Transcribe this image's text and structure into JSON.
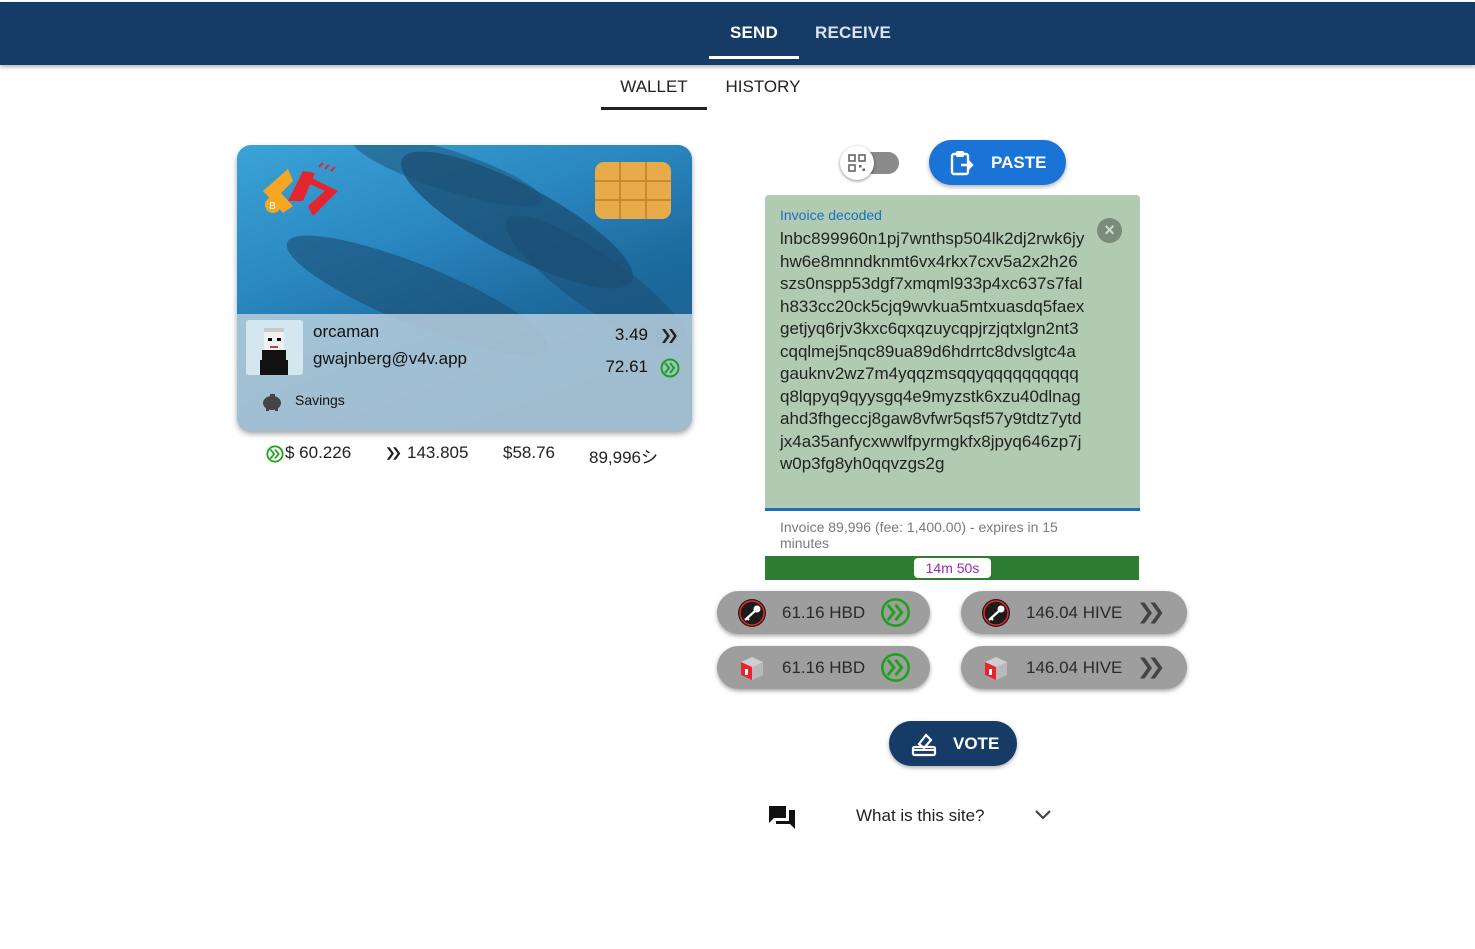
{
  "header": {
    "tabs": [
      {
        "label": "SEND",
        "active": true
      },
      {
        "label": "RECEIVE",
        "active": false
      }
    ]
  },
  "subtabs": [
    {
      "label": "WALLET",
      "active": true
    },
    {
      "label": "HISTORY",
      "active": false
    }
  ],
  "card": {
    "username": "orcaman",
    "address": "gwajnberg@v4v.app",
    "balance_hive": "3.49",
    "balance_hbd": "72.61",
    "savings_label": "Savings"
  },
  "stats": {
    "hbd": "$ 60.226",
    "hive": "143.805",
    "usd": "$58.76",
    "sats": "89,996シ"
  },
  "paste_button": "PASTE",
  "invoice": {
    "label": "Invoice decoded",
    "value": "lnbc899960n1pj7wnthsp504lk2dj2rwk6jyhw6e8mnndknmt6vx4rkx7cxv5a2x2h26szs0nspp53dgf7xmqml933p4xc637s7falh833cc20ck5cjq9wvkua5mtxuasdq5faexgetjyq6rjv3kxc6qxqzuycqpjrzjqtxlgn2nt3cqqlmej5nqc89ua89d6hdrrtc8dvslgtc4agauknv2wz7m4yqqzmsqqyqqqqqqqqqqq8lqpyq9qyysgq4e9myzstk6xzu40dlnagahd3fhgeccj8gaw8vfwr5qsf57y9tdtz7ytdjx4a35anfycxwwlfpyrmgkfx8jpyq646zp7jw0p3fg8yh0qqvzgs2g",
    "helper": "Invoice 89,996 (fee: 1,400.00) - expires in 15 minutes",
    "timer": "14m 50s"
  },
  "pay_buttons": [
    {
      "label": "61.16 HBD",
      "method": "key",
      "currency": "hbd"
    },
    {
      "label": "146.04 HIVE",
      "method": "key",
      "currency": "hive"
    },
    {
      "label": "61.16 HBD",
      "method": "keychain",
      "currency": "hbd"
    },
    {
      "label": "146.04 HIVE",
      "method": "keychain",
      "currency": "hive"
    }
  ],
  "vote_button": "VOTE",
  "faq": {
    "label": "What is this site?"
  },
  "colors": {
    "header": "#173b67",
    "paste": "#1a73d6",
    "invoice_bg": "#b0cbb1",
    "progress": "#2e7d32",
    "hbd_green": "#1aa31a"
  }
}
